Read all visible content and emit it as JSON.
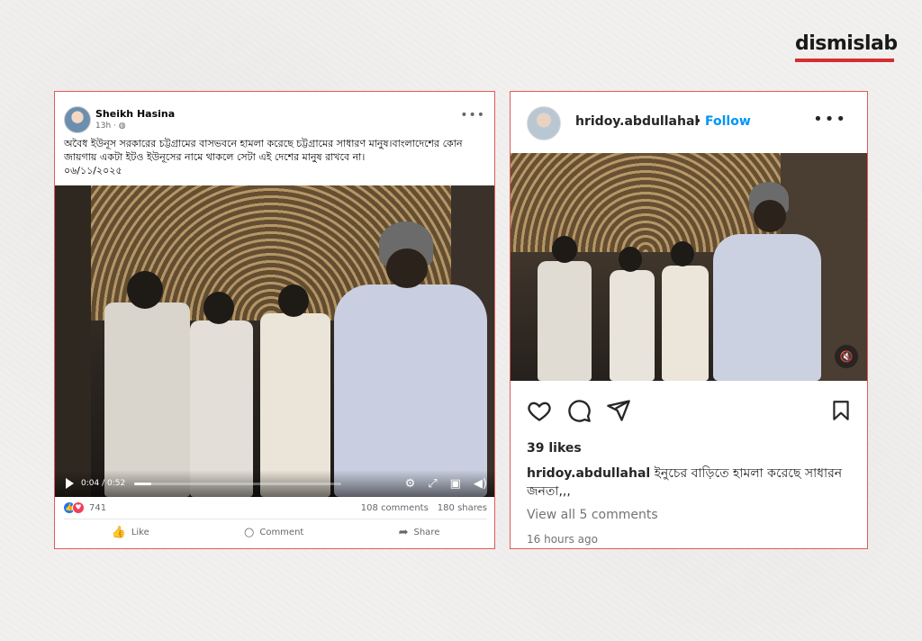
{
  "brand": {
    "name": "dismislab",
    "accent": "#d32f2f"
  },
  "facebook": {
    "author": "Sheikh Hasina",
    "time": "13h · ",
    "globe_icon": "globe-icon",
    "body": "অবৈধ ইউনূস সরকারের চট্টগ্রামের বাসভবনে হামলা করেছে চট্টগ্রামের সাধারণ মানুষ।বাংলাদেশের কোন জায়গায় একটা ইটও ইউনূসের নামে থাকলে সেটা এই দেশের মানুষ রাখবে না।",
    "date": "০৬/১১/২০২৫",
    "video": {
      "time": "0:04 / 0:52",
      "progress": 0.08
    },
    "reactions_count": "741",
    "comments": "108 comments",
    "shares": "180 shares",
    "actions": {
      "like": "Like",
      "comment": "Comment",
      "share": "Share"
    }
  },
  "instagram": {
    "username": "hridoy.abdullahal",
    "follow": "Follow",
    "likes": "39 likes",
    "caption_user": "hridoy.abdullahal",
    "caption_text": "ইনুচের বাড়িতে হামলা করেছে সাধারন জনতা,,,",
    "view_comments": "View all 5 comments",
    "time": "16 hours ago",
    "accent": "#0095f6"
  }
}
